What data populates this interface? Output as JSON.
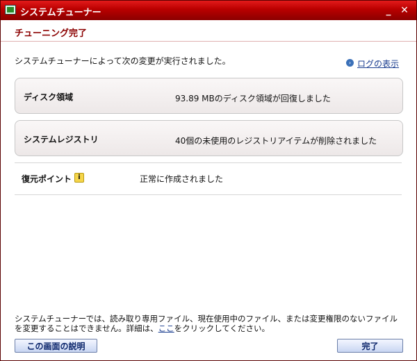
{
  "window": {
    "title": "システムチューナー",
    "minimize": "_",
    "close": "✕"
  },
  "header": {
    "title": "チューニング完了"
  },
  "description": "システムチューナーによって次の変更が実行されました。",
  "log_link": {
    "label": "ログの表示",
    "icon": "arrow-circle-icon"
  },
  "results": [
    {
      "label": "ディスク領域",
      "value": "93.89 MBのディスク領域が回復しました"
    },
    {
      "label": "システムレジストリ",
      "value": "40個の未使用のレジストリアイテムが削除されました"
    }
  ],
  "restore_point": {
    "label": "復元ポイント",
    "icon": "info-icon",
    "value": "正常に作成されました"
  },
  "footer": {
    "note_part1": "システムチューナーでは、読み取り専用ファイル、現在使用中のファイル、または変更権限のないファイルを変更することはできません。詳細は、",
    "note_link": "ここ",
    "note_part2": "をクリックしてください。"
  },
  "buttons": {
    "explain": "この画面の説明",
    "done": "完了"
  }
}
